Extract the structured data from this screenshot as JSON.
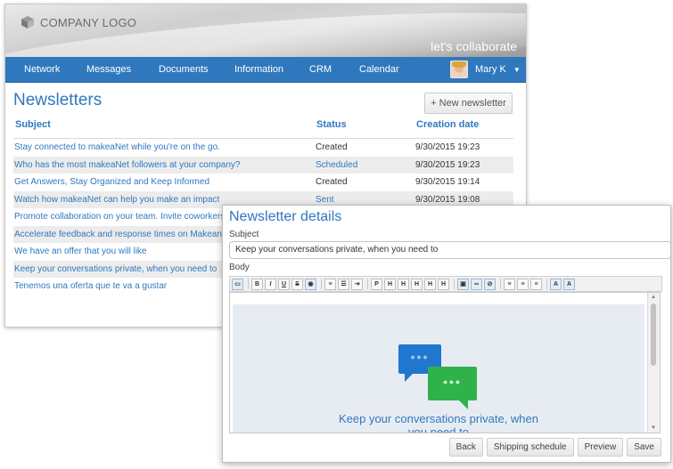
{
  "header": {
    "logo_text": "COMPANY LOGO",
    "tagline": "let's collaborate"
  },
  "nav": {
    "items": [
      "Network",
      "Messages",
      "Documents",
      "Information",
      "CRM",
      "Calendar"
    ],
    "user_name": "Mary K"
  },
  "newsletters": {
    "title": "Newsletters",
    "new_button": "+ New newsletter",
    "columns": [
      "Subject",
      "Status",
      "Creation date"
    ],
    "rows": [
      {
        "subject": "Stay connected to makeaNet while you're on the go.",
        "status": "Created",
        "date": "9/30/2015 19:23"
      },
      {
        "subject": "Who has the most makeaNet followers at your company?",
        "status": "Scheduled",
        "date": "9/30/2015 19:23"
      },
      {
        "subject": "Get Answers, Stay Organized and Keep Informed",
        "status": "Created",
        "date": "9/30/2015 19:14"
      },
      {
        "subject": "Watch how makeaNet can help you make an impact",
        "status": "Sent",
        "date": "9/30/2015 19:08"
      },
      {
        "subject": "Promote collaboration on your team. Invite coworkers to",
        "status": "",
        "date": ""
      },
      {
        "subject": "Accelerate feedback and response times on Makeanet.",
        "status": "",
        "date": ""
      },
      {
        "subject": "We have an offer that you will like",
        "status": "",
        "date": ""
      },
      {
        "subject": "Keep your conversations private, when you need to",
        "status": "",
        "date": ""
      },
      {
        "subject": "Tenemos una oferta que te va a gustar",
        "status": "",
        "date": ""
      }
    ]
  },
  "dialog": {
    "title": "Newsletter details",
    "subject_label": "Subject",
    "subject_value": "Keep your conversations private, when you need to",
    "body_label": "Body",
    "editor_text_line1": "Keep your conversations private, when",
    "editor_text_line2": "you need to",
    "buttons": [
      "Back",
      "Shipping schedule",
      "Preview",
      "Save"
    ]
  },
  "colors": {
    "accent": "#2f78be",
    "nav_bg": "#2f78be",
    "bubble_blue": "#1f77d0",
    "bubble_green": "#2fb24a"
  }
}
